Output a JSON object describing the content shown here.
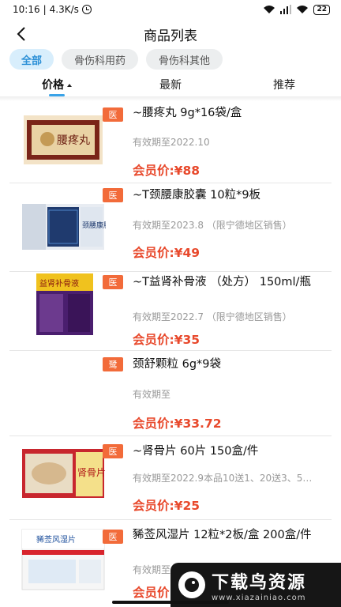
{
  "status_bar": {
    "time": "10:16",
    "network_speed": "4.3K/s",
    "battery": "22",
    "icons": [
      "alarm-icon",
      "wifi-icon",
      "signal-icon",
      "battery-icon"
    ]
  },
  "nav": {
    "title": "商品列表",
    "back_icon": "chevron-left-icon"
  },
  "filters": [
    {
      "label": "全部",
      "active": true
    },
    {
      "label": "骨伤科用药",
      "active": false
    },
    {
      "label": "骨伤科其他",
      "active": false
    }
  ],
  "sort_tabs": [
    {
      "label": "价格",
      "active": true,
      "direction": "ascending"
    },
    {
      "label": "最新",
      "active": false
    },
    {
      "label": "推荐",
      "active": false
    }
  ],
  "colors": {
    "accent": "#3aa3e8",
    "price": "#e8492c",
    "badge": "#f26b3a",
    "chip_active_bg": "#d8eefc"
  },
  "products": [
    {
      "badge": "医",
      "name": "~腰疼丸 9g*16袋/盒",
      "expire": "有效期至2022.10",
      "price_label": "会员价:",
      "price": "¥88",
      "image_text": "腰疼丸"
    },
    {
      "badge": "医",
      "name": "~T颈腰康胶囊 10粒*9板",
      "expire": "有效期至2023.8 （限宁德地区销售）",
      "price_label": "会员价:",
      "price": "¥49",
      "image_text": "颈腰康胶囊"
    },
    {
      "badge": "医",
      "name": "~T益肾补骨液 （处方） 150ml/瓶",
      "expire": "有效期至2022.7 （限宁德地区销售）",
      "price_label": "会员价:",
      "price": "¥35",
      "image_text": "益肾补骨液"
    },
    {
      "badge": "鹭",
      "name": "颈舒颗粒 6g*9袋",
      "expire": "有效期至",
      "price_label": "会员价:",
      "price": "¥33.72",
      "image_text": ""
    },
    {
      "badge": "医",
      "name": "~肾骨片 60片 150盒/件",
      "expire": "有效期至2022.9本品10送1、20送3、5…",
      "price_label": "会员价:",
      "price": "¥25",
      "image_text": "肾骨片"
    },
    {
      "badge": "医",
      "name": "豨莶风湿片 12粒*2板/盒 200盒/件",
      "expire": "有效期至",
      "price_label": "会员价:",
      "price": "¥",
      "image_text": "豨莶风湿片"
    }
  ],
  "watermark": {
    "title": "下载鸟资源",
    "url": "www.xiazainiao.com"
  }
}
